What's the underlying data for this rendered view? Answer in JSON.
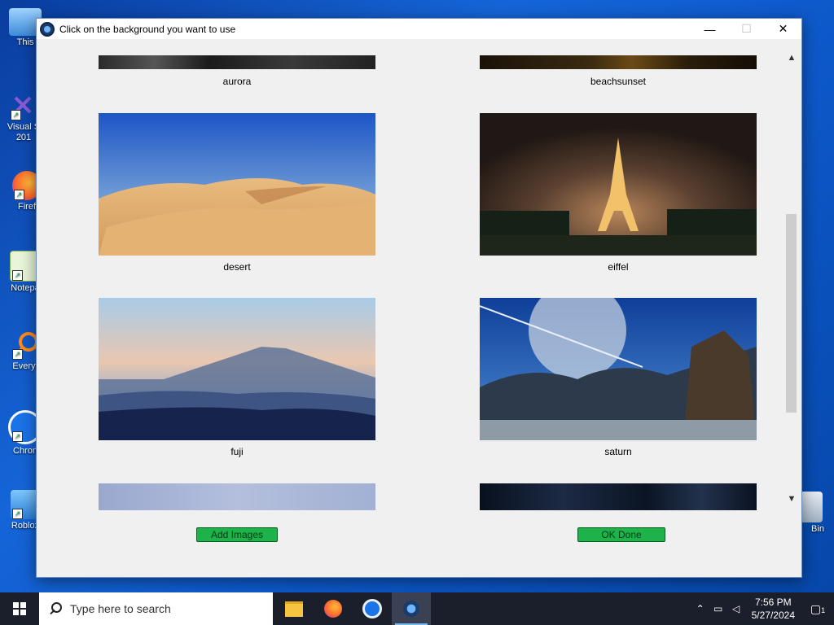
{
  "window": {
    "title": "Click on the background you want to use",
    "minimize_glyph": "—",
    "maximize_glyph": "☐",
    "close_glyph": "✕"
  },
  "images": [
    {
      "name": "aurora"
    },
    {
      "name": "beachsunset"
    },
    {
      "name": "desert"
    },
    {
      "name": "eiffel"
    },
    {
      "name": "fuji"
    },
    {
      "name": "saturn"
    }
  ],
  "buttons": {
    "add_images": "Add Images",
    "ok_done": "OK Done"
  },
  "scrollbar": {
    "up_glyph": "▲",
    "down_glyph": "▼"
  },
  "desktop_icons": [
    {
      "label": "This",
      "icon": "computer-icon"
    },
    {
      "label": "Visual S",
      "label2": "201",
      "icon": "visual-studio-icon"
    },
    {
      "label": "Firef",
      "icon": "firefox-icon"
    },
    {
      "label": "Notepa",
      "icon": "notepad-icon"
    },
    {
      "label": "Everyt",
      "icon": "everything-icon"
    },
    {
      "label": "Chron",
      "icon": "chrome-icon"
    },
    {
      "label": "Roblox",
      "icon": "roblox-icon"
    },
    {
      "label": "Bin",
      "icon": "recycle-bin-icon"
    }
  ],
  "taskbar": {
    "search_placeholder": "Type here to search",
    "time": "7:56 PM",
    "date": "5/27/2024",
    "notification_count": "1"
  },
  "colors": {
    "accent_green": "#1db24a",
    "desktop_blue": "#1565d8",
    "taskbar": "#1a1f2b"
  }
}
